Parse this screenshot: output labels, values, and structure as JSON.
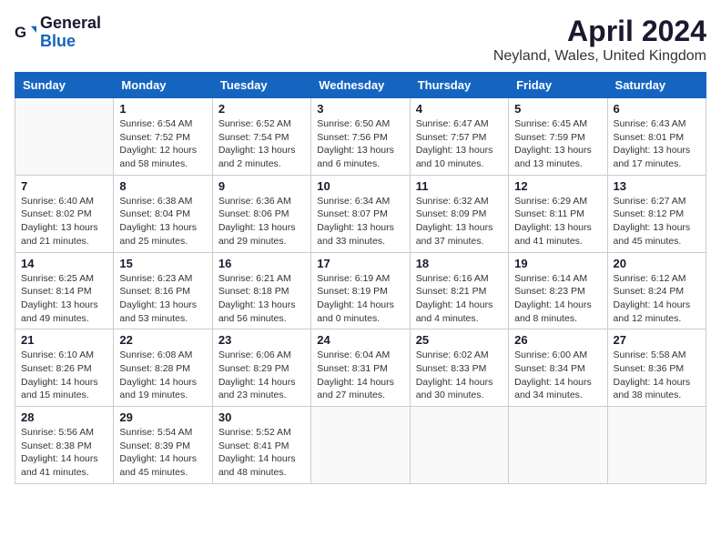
{
  "logo": {
    "general": "General",
    "blue": "Blue"
  },
  "title": "April 2024",
  "location": "Neyland, Wales, United Kingdom",
  "days_of_week": [
    "Sunday",
    "Monday",
    "Tuesday",
    "Wednesday",
    "Thursday",
    "Friday",
    "Saturday"
  ],
  "weeks": [
    [
      {
        "day": "",
        "info": ""
      },
      {
        "day": "1",
        "info": "Sunrise: 6:54 AM\nSunset: 7:52 PM\nDaylight: 12 hours\nand 58 minutes."
      },
      {
        "day": "2",
        "info": "Sunrise: 6:52 AM\nSunset: 7:54 PM\nDaylight: 13 hours\nand 2 minutes."
      },
      {
        "day": "3",
        "info": "Sunrise: 6:50 AM\nSunset: 7:56 PM\nDaylight: 13 hours\nand 6 minutes."
      },
      {
        "day": "4",
        "info": "Sunrise: 6:47 AM\nSunset: 7:57 PM\nDaylight: 13 hours\nand 10 minutes."
      },
      {
        "day": "5",
        "info": "Sunrise: 6:45 AM\nSunset: 7:59 PM\nDaylight: 13 hours\nand 13 minutes."
      },
      {
        "day": "6",
        "info": "Sunrise: 6:43 AM\nSunset: 8:01 PM\nDaylight: 13 hours\nand 17 minutes."
      }
    ],
    [
      {
        "day": "7",
        "info": "Sunrise: 6:40 AM\nSunset: 8:02 PM\nDaylight: 13 hours\nand 21 minutes."
      },
      {
        "day": "8",
        "info": "Sunrise: 6:38 AM\nSunset: 8:04 PM\nDaylight: 13 hours\nand 25 minutes."
      },
      {
        "day": "9",
        "info": "Sunrise: 6:36 AM\nSunset: 8:06 PM\nDaylight: 13 hours\nand 29 minutes."
      },
      {
        "day": "10",
        "info": "Sunrise: 6:34 AM\nSunset: 8:07 PM\nDaylight: 13 hours\nand 33 minutes."
      },
      {
        "day": "11",
        "info": "Sunrise: 6:32 AM\nSunset: 8:09 PM\nDaylight: 13 hours\nand 37 minutes."
      },
      {
        "day": "12",
        "info": "Sunrise: 6:29 AM\nSunset: 8:11 PM\nDaylight: 13 hours\nand 41 minutes."
      },
      {
        "day": "13",
        "info": "Sunrise: 6:27 AM\nSunset: 8:12 PM\nDaylight: 13 hours\nand 45 minutes."
      }
    ],
    [
      {
        "day": "14",
        "info": "Sunrise: 6:25 AM\nSunset: 8:14 PM\nDaylight: 13 hours\nand 49 minutes."
      },
      {
        "day": "15",
        "info": "Sunrise: 6:23 AM\nSunset: 8:16 PM\nDaylight: 13 hours\nand 53 minutes."
      },
      {
        "day": "16",
        "info": "Sunrise: 6:21 AM\nSunset: 8:18 PM\nDaylight: 13 hours\nand 56 minutes."
      },
      {
        "day": "17",
        "info": "Sunrise: 6:19 AM\nSunset: 8:19 PM\nDaylight: 14 hours\nand 0 minutes."
      },
      {
        "day": "18",
        "info": "Sunrise: 6:16 AM\nSunset: 8:21 PM\nDaylight: 14 hours\nand 4 minutes."
      },
      {
        "day": "19",
        "info": "Sunrise: 6:14 AM\nSunset: 8:23 PM\nDaylight: 14 hours\nand 8 minutes."
      },
      {
        "day": "20",
        "info": "Sunrise: 6:12 AM\nSunset: 8:24 PM\nDaylight: 14 hours\nand 12 minutes."
      }
    ],
    [
      {
        "day": "21",
        "info": "Sunrise: 6:10 AM\nSunset: 8:26 PM\nDaylight: 14 hours\nand 15 minutes."
      },
      {
        "day": "22",
        "info": "Sunrise: 6:08 AM\nSunset: 8:28 PM\nDaylight: 14 hours\nand 19 minutes."
      },
      {
        "day": "23",
        "info": "Sunrise: 6:06 AM\nSunset: 8:29 PM\nDaylight: 14 hours\nand 23 minutes."
      },
      {
        "day": "24",
        "info": "Sunrise: 6:04 AM\nSunset: 8:31 PM\nDaylight: 14 hours\nand 27 minutes."
      },
      {
        "day": "25",
        "info": "Sunrise: 6:02 AM\nSunset: 8:33 PM\nDaylight: 14 hours\nand 30 minutes."
      },
      {
        "day": "26",
        "info": "Sunrise: 6:00 AM\nSunset: 8:34 PM\nDaylight: 14 hours\nand 34 minutes."
      },
      {
        "day": "27",
        "info": "Sunrise: 5:58 AM\nSunset: 8:36 PM\nDaylight: 14 hours\nand 38 minutes."
      }
    ],
    [
      {
        "day": "28",
        "info": "Sunrise: 5:56 AM\nSunset: 8:38 PM\nDaylight: 14 hours\nand 41 minutes."
      },
      {
        "day": "29",
        "info": "Sunrise: 5:54 AM\nSunset: 8:39 PM\nDaylight: 14 hours\nand 45 minutes."
      },
      {
        "day": "30",
        "info": "Sunrise: 5:52 AM\nSunset: 8:41 PM\nDaylight: 14 hours\nand 48 minutes."
      },
      {
        "day": "",
        "info": ""
      },
      {
        "day": "",
        "info": ""
      },
      {
        "day": "",
        "info": ""
      },
      {
        "day": "",
        "info": ""
      }
    ]
  ]
}
